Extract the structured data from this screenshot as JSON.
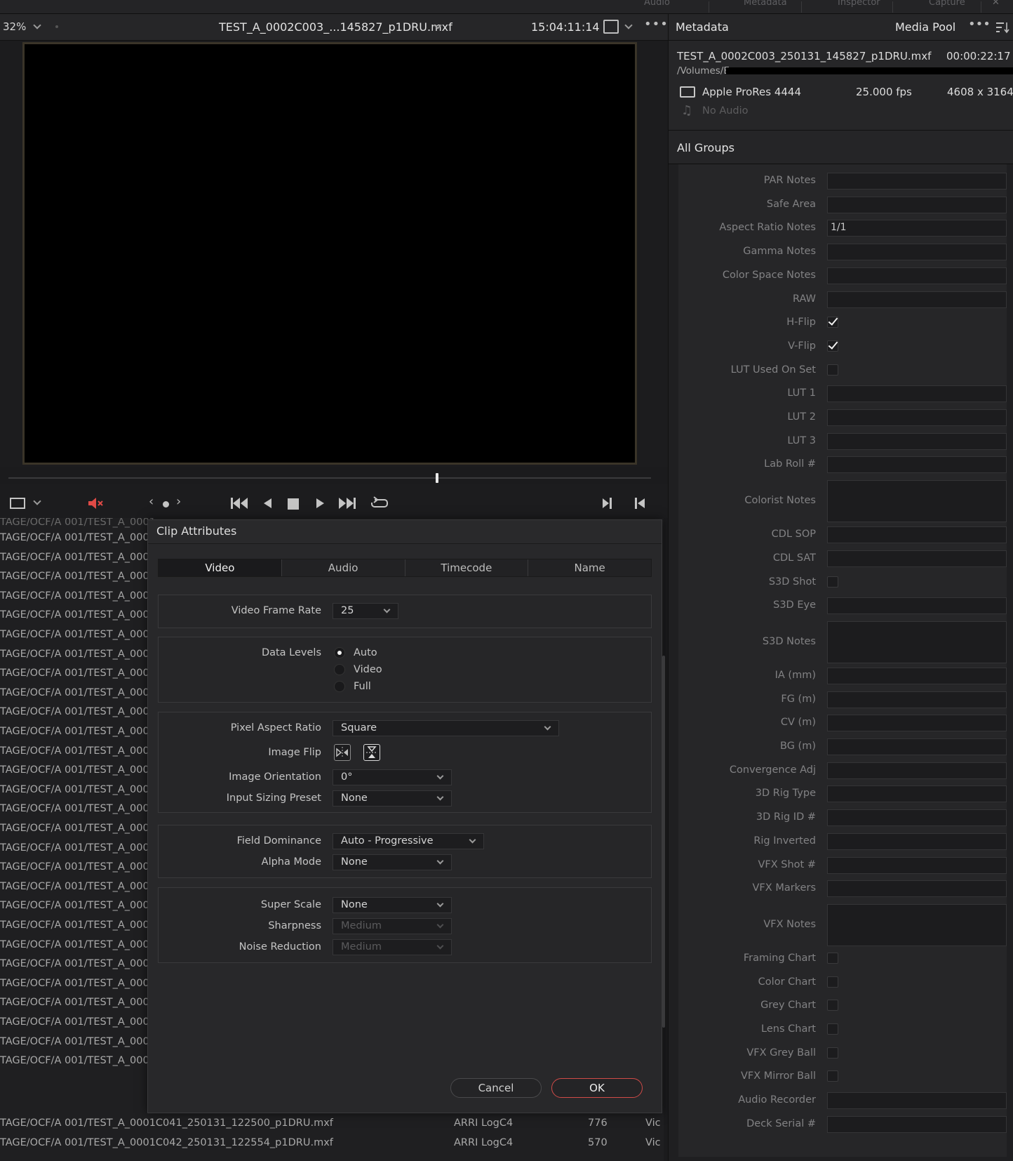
{
  "topbar": {
    "tabs": [
      "Audio",
      "Metadata",
      "Inspector",
      "Capture"
    ]
  },
  "viewer": {
    "zoom": "32%",
    "clip_name": "TEST_A_0002C003_...145827_p1DRU.mxf",
    "timecode": "15:04:11:14"
  },
  "right_header": {
    "metadata_label": "Metadata",
    "media_pool_label": "Media Pool"
  },
  "clip_info": {
    "filename": "TEST_A_0002C003_250131_145827_p1DRU.mxf",
    "duration": "00:00:22:17",
    "path": "/Volumes/E",
    "codec": "Apple ProRes 4444",
    "fps": "25.000 fps",
    "resolution": "4608 x 3164",
    "audio": "No Audio"
  },
  "groups_label": "All Groups",
  "metadata_fields": [
    {
      "label": "PAR Notes",
      "type": "text",
      "value": ""
    },
    {
      "label": "Safe Area",
      "type": "text",
      "value": ""
    },
    {
      "label": "Aspect Ratio Notes",
      "type": "text",
      "value": "1/1"
    },
    {
      "label": "Gamma Notes",
      "type": "text",
      "value": ""
    },
    {
      "label": "Color Space Notes",
      "type": "text",
      "value": ""
    },
    {
      "label": "RAW",
      "type": "text",
      "value": ""
    },
    {
      "label": "H-Flip",
      "type": "check",
      "checked": true
    },
    {
      "label": "V-Flip",
      "type": "check",
      "checked": true
    },
    {
      "label": "LUT Used On Set",
      "type": "check",
      "checked": false
    },
    {
      "label": "LUT 1",
      "type": "text",
      "value": ""
    },
    {
      "label": "LUT 2",
      "type": "text",
      "value": ""
    },
    {
      "label": "LUT 3",
      "type": "text",
      "value": ""
    },
    {
      "label": "Lab Roll #",
      "type": "text",
      "value": ""
    },
    {
      "label": "Colorist Notes",
      "type": "area",
      "value": ""
    },
    {
      "label": "CDL SOP",
      "type": "text",
      "value": ""
    },
    {
      "label": "CDL SAT",
      "type": "text",
      "value": ""
    },
    {
      "label": "S3D Shot",
      "type": "check",
      "checked": false
    },
    {
      "label": "S3D Eye",
      "type": "text",
      "value": ""
    },
    {
      "label": "S3D Notes",
      "type": "area",
      "value": ""
    },
    {
      "label": "IA (mm)",
      "type": "text",
      "value": ""
    },
    {
      "label": "FG (m)",
      "type": "text",
      "value": ""
    },
    {
      "label": "CV (m)",
      "type": "text",
      "value": ""
    },
    {
      "label": "BG (m)",
      "type": "text",
      "value": ""
    },
    {
      "label": "Convergence Adj",
      "type": "text",
      "value": ""
    },
    {
      "label": "3D Rig Type",
      "type": "text",
      "value": ""
    },
    {
      "label": "3D Rig ID #",
      "type": "text",
      "value": ""
    },
    {
      "label": "Rig Inverted",
      "type": "text",
      "value": ""
    },
    {
      "label": "VFX Shot #",
      "type": "text",
      "value": ""
    },
    {
      "label": "VFX Markers",
      "type": "text",
      "value": ""
    },
    {
      "label": "VFX Notes",
      "type": "area",
      "value": ""
    },
    {
      "label": "Framing Chart",
      "type": "check",
      "checked": false
    },
    {
      "label": "Color Chart",
      "type": "check",
      "checked": false
    },
    {
      "label": "Grey Chart",
      "type": "check",
      "checked": false
    },
    {
      "label": "Lens Chart",
      "type": "check",
      "checked": false
    },
    {
      "label": "VFX Grey Ball",
      "type": "check",
      "checked": false
    },
    {
      "label": "VFX Mirror Ball",
      "type": "check",
      "checked": false
    },
    {
      "label": "Audio Recorder",
      "type": "text",
      "value": ""
    },
    {
      "label": "Deck Serial #",
      "type": "text",
      "value": ""
    }
  ],
  "bin_rows": {
    "repeated_path": "TAGE/OCF/A 001/TEST_A_0001",
    "top_row_partial": "TAGE/OCF/A 001/TEST_A_0001",
    "visible_rows": [
      {
        "path": "TAGE/OCF/A 001/TEST_A_0001C041_250131_122500_p1DRU.mxf",
        "gamma": "ARRI LogC4",
        "frames": "776",
        "type": "Vic"
      },
      {
        "path": "TAGE/OCF/A 001/TEST_A_0001C042_250131_122554_p1DRU.mxf",
        "gamma": "ARRI LogC4",
        "frames": "570",
        "type": "Vic"
      }
    ]
  },
  "dialog": {
    "title": "Clip Attributes",
    "tabs": [
      "Video",
      "Audio",
      "Timecode",
      "Name"
    ],
    "active_tab": "Video",
    "video_frame_rate_label": "Video Frame Rate",
    "video_frame_rate": "25",
    "data_levels_label": "Data Levels",
    "data_levels_options": [
      "Auto",
      "Video",
      "Full"
    ],
    "data_levels_selected": "Auto",
    "pixel_aspect_ratio_label": "Pixel Aspect Ratio",
    "pixel_aspect_ratio": "Square",
    "image_flip_label": "Image Flip",
    "image_orientation_label": "Image Orientation",
    "image_orientation": "0°",
    "input_sizing_preset_label": "Input Sizing Preset",
    "input_sizing_preset": "None",
    "field_dominance_label": "Field Dominance",
    "field_dominance": "Auto - Progressive",
    "alpha_mode_label": "Alpha Mode",
    "alpha_mode": "None",
    "super_scale_label": "Super Scale",
    "super_scale": "None",
    "sharpness_label": "Sharpness",
    "sharpness": "Medium",
    "noise_reduction_label": "Noise Reduction",
    "noise_reduction": "Medium",
    "cancel_label": "Cancel",
    "ok_label": "OK"
  },
  "colors": {
    "ok_border": "#d04b48",
    "mute_icon": "#e04a46",
    "panel_bg": "#262628"
  }
}
